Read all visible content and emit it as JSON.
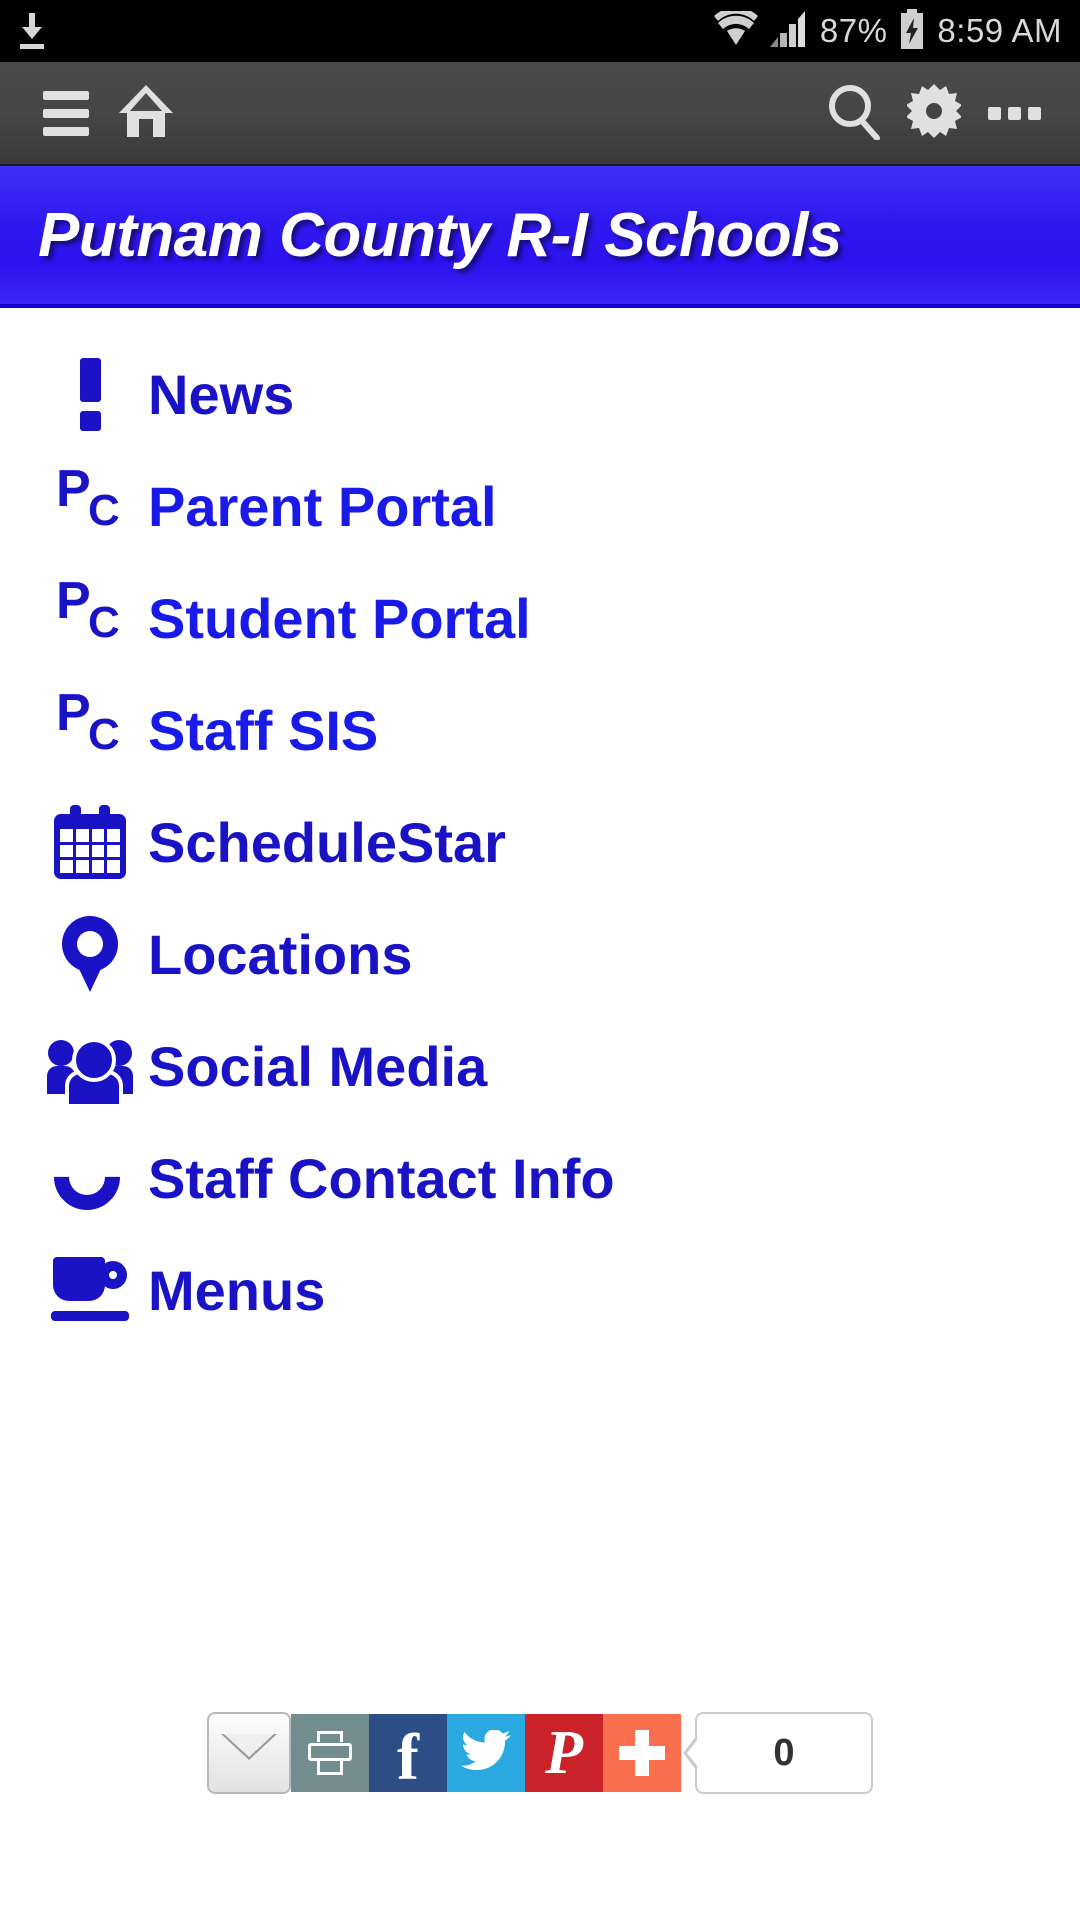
{
  "status_bar": {
    "download_icon": "download-icon",
    "wifi_icon": "wifi-icon",
    "signal_icon": "cellular-signal-icon",
    "battery_percent": "87%",
    "battery_icon": "battery-charging-icon",
    "time": "8:59 AM"
  },
  "toolbar": {
    "menu_icon": "hamburger-menu-icon",
    "home_icon": "home-icon",
    "search_icon": "search-icon",
    "settings_icon": "gear-icon",
    "overflow_icon": "overflow-menu-icon"
  },
  "header": {
    "title": "Putnam County R-I Schools",
    "background_color": "#2f19f0",
    "text_color": "#ffffff"
  },
  "menu": {
    "link_color": "#1a1ae8",
    "items": [
      {
        "label": "News",
        "icon": "exclamation-icon"
      },
      {
        "label": "Parent Portal",
        "icon": "pc-logo-icon"
      },
      {
        "label": "Student Portal",
        "icon": "pc-logo-icon"
      },
      {
        "label": "Staff SIS",
        "icon": "pc-logo-icon"
      },
      {
        "label": "ScheduleStar",
        "icon": "calendar-icon"
      },
      {
        "label": "Locations",
        "icon": "map-pin-icon"
      },
      {
        "label": "Social Media",
        "icon": "people-group-icon"
      },
      {
        "label": "Staff Contact Info",
        "icon": "phone-icon"
      },
      {
        "label": "Menus",
        "icon": "coffee-cup-icon"
      }
    ],
    "pc_logo": {
      "primary": "P",
      "secondary": "C"
    }
  },
  "share_bar": {
    "buttons": [
      {
        "name": "email",
        "icon": "envelope-icon",
        "color": "#e8e8e8"
      },
      {
        "name": "print",
        "icon": "printer-icon",
        "color": "#738c8f"
      },
      {
        "name": "facebook",
        "icon": "facebook-icon",
        "glyph": "f",
        "color": "#2d4d86"
      },
      {
        "name": "twitter",
        "icon": "twitter-bird-icon",
        "glyph": "ᴠ",
        "color": "#29a9e0"
      },
      {
        "name": "pinterest",
        "icon": "pinterest-icon",
        "glyph": "P",
        "color": "#c92228"
      },
      {
        "name": "addthis",
        "icon": "plus-icon",
        "color": "#f96f4e"
      }
    ],
    "share_count": "0"
  }
}
